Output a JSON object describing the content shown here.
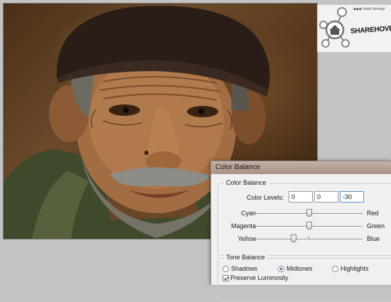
{
  "watermark": {
    "brand": "SHAREHOVEL",
    "tagline": "◆◆◆ Indah Berbagi"
  },
  "dialog": {
    "title": "Color Balance",
    "color_balance": {
      "heading": "Color Balance",
      "levels_label": "Color Levels:",
      "levels": [
        "0",
        "0",
        "-30"
      ],
      "sliders": [
        {
          "left": "Cyan",
          "right": "Red",
          "value": 0
        },
        {
          "left": "Magenta",
          "right": "Green",
          "value": 0
        },
        {
          "left": "Yellow",
          "right": "Blue",
          "value": -30
        }
      ],
      "slider_range": [
        -100,
        100
      ]
    },
    "tone_balance": {
      "heading": "Tone Balance",
      "options": [
        "Shadows",
        "Midtones",
        "Highlights"
      ],
      "selected": "Midtones",
      "preserve_label": "Preserve Luminosity",
      "preserve_checked": true
    }
  }
}
